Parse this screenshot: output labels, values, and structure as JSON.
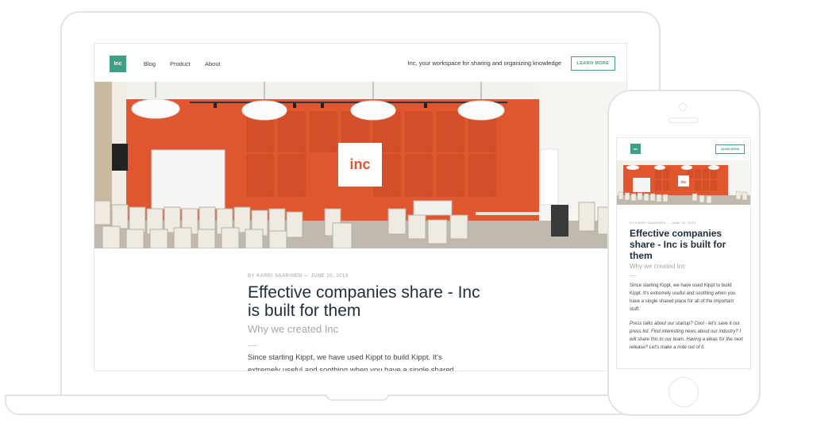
{
  "nav": {
    "logo": "Inc",
    "links": [
      "Blog",
      "Product",
      "About"
    ],
    "tagline": "Inc, your workspace for sharing and organizing knowledge",
    "cta": "LEARN MORE"
  },
  "hero": {
    "logo_text": "inc",
    "wall_color": "#e0572f"
  },
  "article": {
    "byline": "BY KARRI SAARINEN — JUNE 20, 2013",
    "title": "Effective companies share - Inc is built for them",
    "subtitle": "Why we created Inc",
    "body": "Since starting Kippt, we have used Kippt to build Kippt. It's extremely useful and soothing when you have a single shared"
  },
  "phone": {
    "logo": "Inc",
    "cta": "LEARN MORE",
    "byline": "BY KARRI SAARINEN — JUNE 20, 2013",
    "title": "Effective companies share - Inc is built for them",
    "subtitle": "Why we created Inc",
    "body1": "Since starting Kippt, we have used Kippt to build Kippt. It's extremely useful and soothing when you have a single shared place for all of the important stuff.",
    "body2": "Press talks about our startup? Cool - let's save it our press list. Find interesting news about our industry? I will share this to our team. Having a ideas for the next release? Let's make a note out of it."
  },
  "colors": {
    "accent": "#3e9e86",
    "title": "#1f2d3d"
  }
}
